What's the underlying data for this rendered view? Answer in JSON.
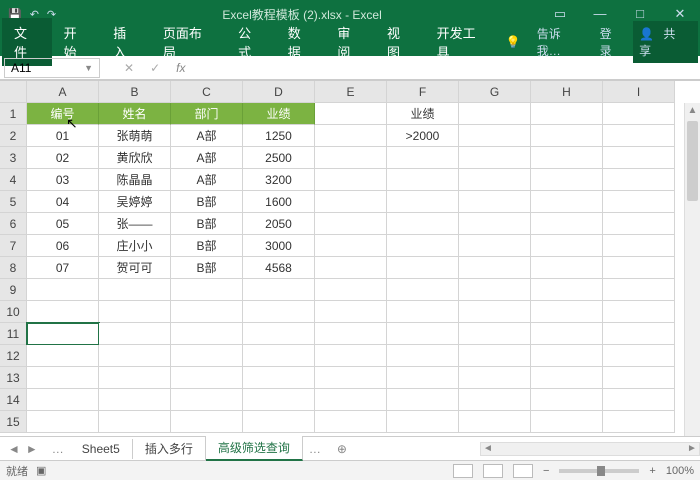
{
  "window": {
    "title": "Excel教程模板 (2).xlsx - Excel"
  },
  "ribbon": {
    "tabs": [
      "文件",
      "开始",
      "插入",
      "页面布局",
      "公式",
      "数据",
      "审阅",
      "视图",
      "开发工具"
    ],
    "tell_me": "告诉我…",
    "login": "登录",
    "share": "共享"
  },
  "namebox": {
    "value": "A11"
  },
  "formula_bar": {
    "value": ""
  },
  "columns": [
    "A",
    "B",
    "C",
    "D",
    "E",
    "F",
    "G",
    "H",
    "I"
  ],
  "row_count": 15,
  "table": {
    "headers": [
      "编号",
      "姓名",
      "部门",
      "业绩"
    ],
    "rows": [
      [
        "01",
        "张萌萌",
        "A部",
        "1250"
      ],
      [
        "02",
        "黄欣欣",
        "A部",
        "2500"
      ],
      [
        "03",
        "陈晶晶",
        "A部",
        "3200"
      ],
      [
        "04",
        "吴婷婷",
        "B部",
        "1600"
      ],
      [
        "05",
        "张——",
        "B部",
        "2050"
      ],
      [
        "06",
        "庄小小",
        "B部",
        "3000"
      ],
      [
        "07",
        "贺可可",
        "B部",
        "4568"
      ]
    ]
  },
  "criteria": {
    "header": "业绩",
    "value": ">2000"
  },
  "sheets": {
    "tabs": [
      "Sheet5",
      "插入多行",
      "高级筛选查询"
    ],
    "active": 2
  },
  "statusbar": {
    "ready": "就绪",
    "zoom": "100%"
  },
  "colors": {
    "brand": "#0e7140",
    "header_green": "#7cb342"
  }
}
